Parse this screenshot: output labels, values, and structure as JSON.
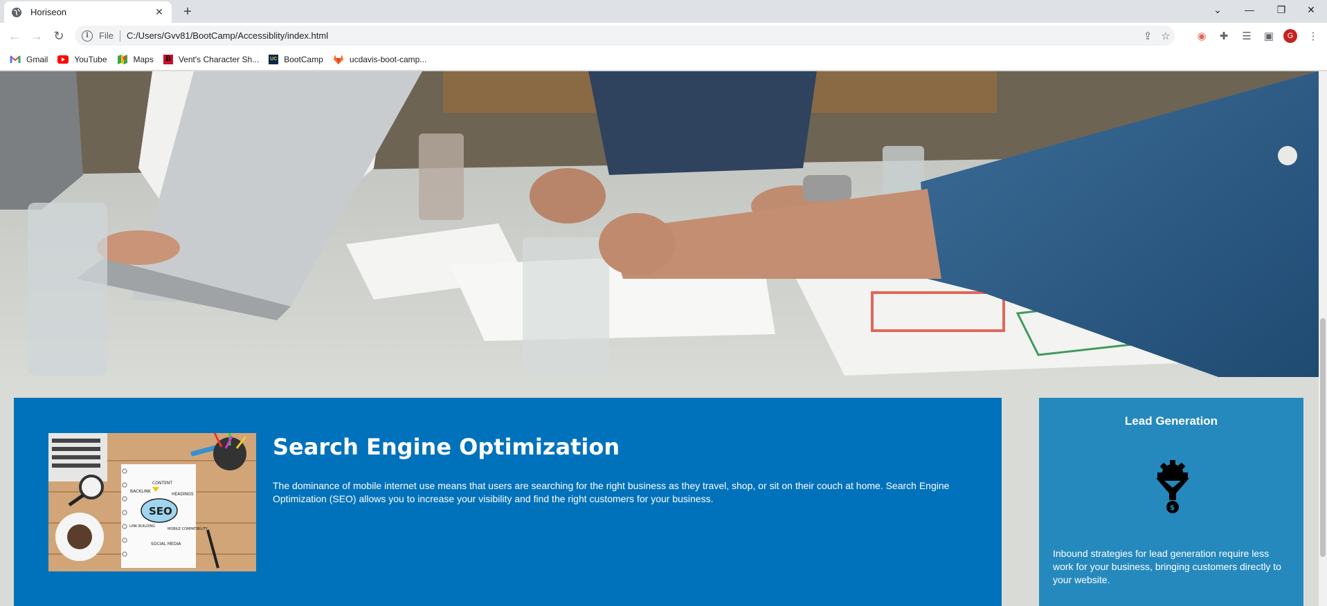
{
  "browser": {
    "tab_title": "Horiseon",
    "address_scheme": "File",
    "address_url": "C:/Users/Gvv81/BootCamp/Accessiblity/index.html",
    "profile_initial": "G",
    "bookmarks": [
      {
        "label": "Gmail",
        "icon": "gmail-icon"
      },
      {
        "label": "YouTube",
        "icon": "youtube-icon"
      },
      {
        "label": "Maps",
        "icon": "maps-icon"
      },
      {
        "label": "Vent's Character Sh...",
        "icon": "b-badge-icon"
      },
      {
        "label": "BootCamp",
        "icon": "ucdavis-icon"
      },
      {
        "label": "ucdavis-boot-camp...",
        "icon": "gitlab-icon"
      }
    ]
  },
  "page": {
    "hero_alt": "hero-office-photo",
    "seo": {
      "title": "Search Engine Optimization",
      "text": "The dominance of mobile internet use means that users are searching for the right business as they travel, shop, or sit on their couch at home. Search Engine Optimization (SEO) allows you to increase your visibility and find the right customers for your business.",
      "image_words": [
        "CONTENT",
        "BACKLINK",
        "HEADINGS",
        "SEO",
        "LINK BUILDING",
        "MOBILE COMPATIBILITY",
        "SOCIAL MEDIA"
      ]
    },
    "lead_generation": {
      "title": "Lead Generation",
      "text": "Inbound strategies for lead generation require less work for your business, bringing customers directly to your website."
    }
  },
  "colors": {
    "content_bg": "#0072bb",
    "aside_bg": "#2589bd",
    "page_bg": "#d9dcd6"
  }
}
